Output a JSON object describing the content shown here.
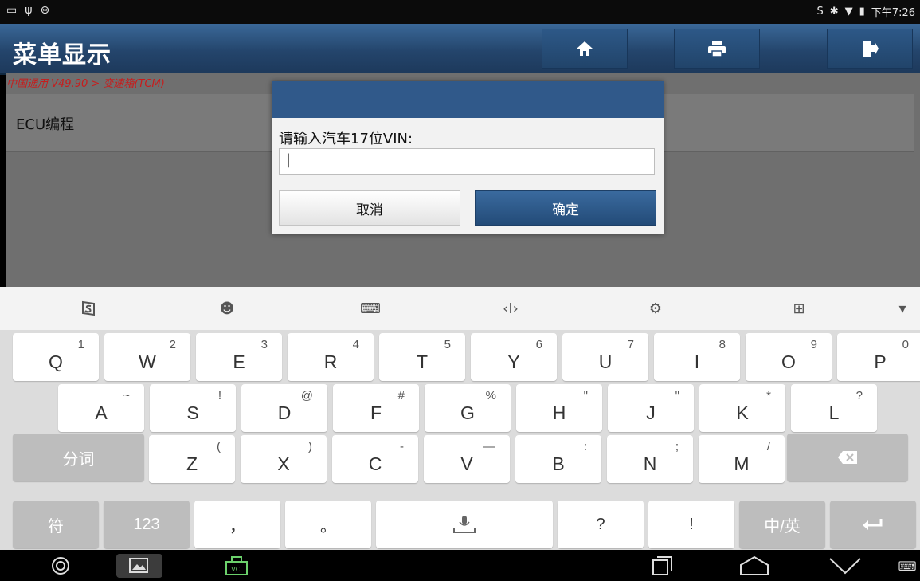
{
  "status": {
    "time": "下午7:26"
  },
  "app": {
    "title": "菜单显示",
    "breadcrumb": "中国通用 V49.90 > 变速箱(TCM)"
  },
  "menu": {
    "items": [
      "ECU编程"
    ]
  },
  "dialog": {
    "prompt": "请输入汽车17位VIN:",
    "input_value": "|",
    "cancel_label": "取消",
    "ok_label": "确定"
  },
  "keyboard": {
    "row1": [
      {
        "k": "Q",
        "s": "1"
      },
      {
        "k": "W",
        "s": "2"
      },
      {
        "k": "E",
        "s": "3"
      },
      {
        "k": "R",
        "s": "4"
      },
      {
        "k": "T",
        "s": "5"
      },
      {
        "k": "Y",
        "s": "6"
      },
      {
        "k": "U",
        "s": "7"
      },
      {
        "k": "I",
        "s": "8"
      },
      {
        "k": "O",
        "s": "9"
      },
      {
        "k": "P",
        "s": "0"
      }
    ],
    "row2": [
      {
        "k": "A",
        "s": "~"
      },
      {
        "k": "S",
        "s": "!"
      },
      {
        "k": "D",
        "s": "@"
      },
      {
        "k": "F",
        "s": "#"
      },
      {
        "k": "G",
        "s": "%"
      },
      {
        "k": "H",
        "s": "\""
      },
      {
        "k": "J",
        "s": "\""
      },
      {
        "k": "K",
        "s": "*"
      },
      {
        "k": "L",
        "s": "?"
      }
    ],
    "row3": [
      {
        "k": "Z",
        "s": "("
      },
      {
        "k": "X",
        "s": ")"
      },
      {
        "k": "C",
        "s": "-"
      },
      {
        "k": "V",
        "s": "—"
      },
      {
        "k": "B",
        "s": ":"
      },
      {
        "k": "N",
        "s": ";"
      },
      {
        "k": "M",
        "s": "/"
      }
    ],
    "fenci": "分词",
    "fu": "符",
    "num": "123",
    "comma": "，",
    "period": "。",
    "question": "?",
    "exclaim": "!",
    "lang": "中/英"
  }
}
